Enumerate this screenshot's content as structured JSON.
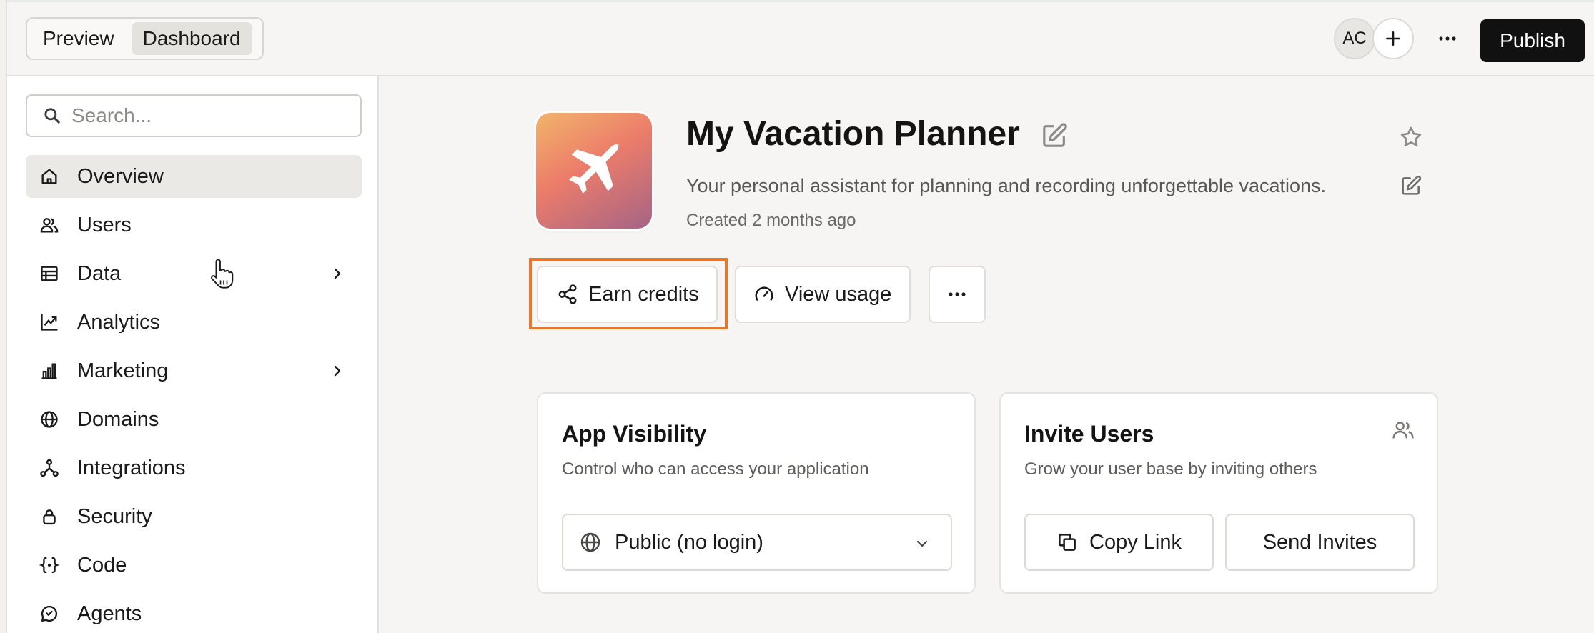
{
  "header": {
    "toggle": {
      "preview_label": "Preview",
      "dashboard_label": "Dashboard",
      "active": "Dashboard"
    },
    "avatar_initials": "AC",
    "add_icon": "plus-icon",
    "more_icon": "more-horizontal-icon",
    "publish_label": "Publish"
  },
  "sidebar": {
    "search": {
      "placeholder": "Search...",
      "value": "",
      "icon": "search-icon"
    },
    "items": [
      {
        "label": "Overview",
        "icon": "home-icon",
        "active": true,
        "has_submenu": false
      },
      {
        "label": "Users",
        "icon": "users-icon",
        "active": false,
        "has_submenu": false
      },
      {
        "label": "Data",
        "icon": "table-icon",
        "active": false,
        "has_submenu": true
      },
      {
        "label": "Analytics",
        "icon": "trend-icon",
        "active": false,
        "has_submenu": false
      },
      {
        "label": "Marketing",
        "icon": "bar-chart-icon",
        "active": false,
        "has_submenu": true
      },
      {
        "label": "Domains",
        "icon": "globe-icon",
        "active": false,
        "has_submenu": false
      },
      {
        "label": "Integrations",
        "icon": "integrations-icon",
        "active": false,
        "has_submenu": false
      },
      {
        "label": "Security",
        "icon": "lock-icon",
        "active": false,
        "has_submenu": false
      },
      {
        "label": "Code",
        "icon": "code-braces-icon",
        "active": false,
        "has_submenu": false
      },
      {
        "label": "Agents",
        "icon": "agent-icon",
        "active": false,
        "has_submenu": false
      }
    ]
  },
  "app": {
    "icon": "airplane-icon",
    "title": "My Vacation Planner",
    "description": "Your personal assistant for planning and recording unforgettable vacations.",
    "created": "Created 2 months ago",
    "actions": {
      "earn_credits": "Earn credits",
      "view_usage": "View usage",
      "more_icon": "more-horizontal-icon"
    }
  },
  "cards": {
    "visibility": {
      "title": "App Visibility",
      "subtitle": "Control who can access your application",
      "selected": "Public (no login)"
    },
    "invite": {
      "title": "Invite Users",
      "subtitle": "Grow your user base by inviting others",
      "copy_label": "Copy Link",
      "send_label": "Send Invites"
    }
  },
  "colors": {
    "highlight": "#e8772e",
    "publish_bg": "#111111",
    "page_bg": "#f6f5f3"
  }
}
